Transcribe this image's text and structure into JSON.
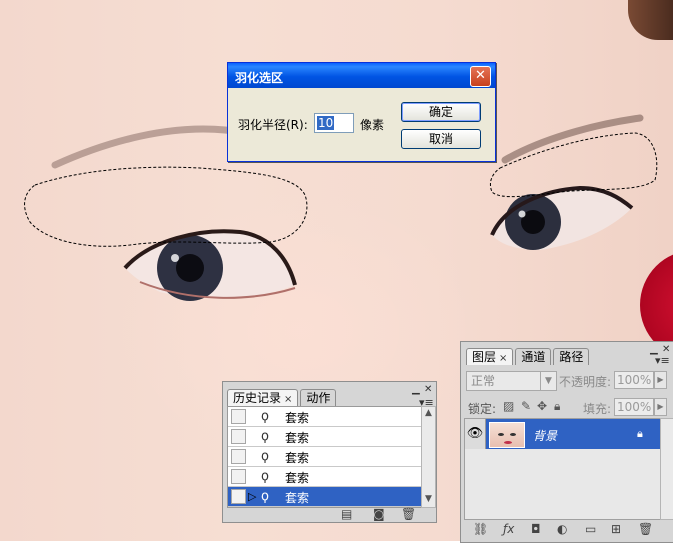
{
  "feather_dialog": {
    "title": "羽化选区",
    "radius_label": "羽化半径(R):",
    "radius_value": "10",
    "unit": "像素",
    "ok_label": "确定",
    "cancel_label": "取消"
  },
  "history_panel": {
    "tabs": [
      {
        "label": "历史记录",
        "active": true
      },
      {
        "label": "动作",
        "active": false
      }
    ],
    "items": [
      {
        "label": "套索",
        "active": false
      },
      {
        "label": "套索",
        "active": false
      },
      {
        "label": "套索",
        "active": false
      },
      {
        "label": "套索",
        "active": false
      },
      {
        "label": "套索",
        "active": true
      }
    ]
  },
  "layers_panel": {
    "tabs": [
      {
        "label": "图层",
        "active": true
      },
      {
        "label": "通道",
        "active": false
      },
      {
        "label": "路径",
        "active": false
      }
    ],
    "blend_mode": "正常",
    "opacity_label": "不透明度:",
    "opacity_value": "100%",
    "lock_label": "锁定:",
    "fill_label": "填充:",
    "fill_value": "100%",
    "layers": [
      {
        "name": "背景",
        "visible": true,
        "locked": true,
        "selected": true
      }
    ]
  },
  "colors": {
    "selection_blue": "#2f62c3",
    "xp_title_blue": "#0054e3",
    "panel_gray": "#d6d6d6"
  }
}
